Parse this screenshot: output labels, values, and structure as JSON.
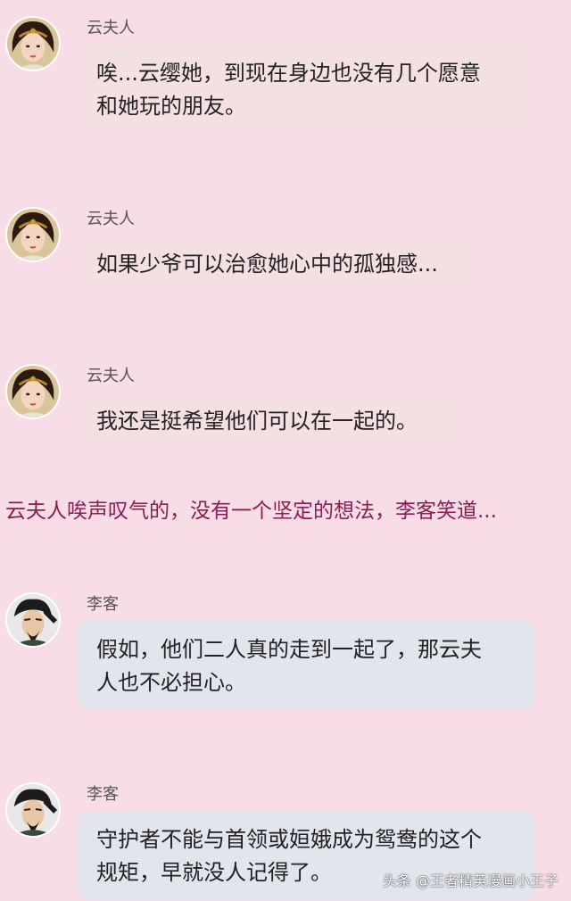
{
  "colors": {
    "background": "#f9dde6",
    "yun_bubble": "#f4dfe2",
    "li_bubble": "#e2e5ee",
    "narration": "#8a1c56"
  },
  "messages": [
    {
      "speaker": "云夫人",
      "avatar": "lady-yun-avatar-icon",
      "lines": [
        "唉...云缨她，到现在身边也没有几个愿意",
        "和她玩的朋友。"
      ]
    },
    {
      "speaker": "云夫人",
      "avatar": "lady-yun-avatar-icon",
      "lines": [
        "如果少爷可以治愈她心中的孤独感..."
      ]
    },
    {
      "speaker": "云夫人",
      "avatar": "lady-yun-avatar-icon",
      "lines": [
        "我还是挺希望他们可以在一起的。"
      ]
    },
    {
      "speaker": "李客",
      "avatar": "li-ke-avatar-icon",
      "lines": [
        "假如，他们二人真的走到一起了，那云夫",
        "人也不必担心。"
      ]
    },
    {
      "speaker": "李客",
      "avatar": "li-ke-avatar-icon",
      "lines": [
        "守护者不能与首领或姮娥成为鸳鸯的这个",
        "规矩，早就没人记得了。"
      ]
    }
  ],
  "narration": "云夫人唉声叹气的，没有一个坚定的想法，李客笑道...",
  "watermark": "头条 @王者精英漫画小王子"
}
